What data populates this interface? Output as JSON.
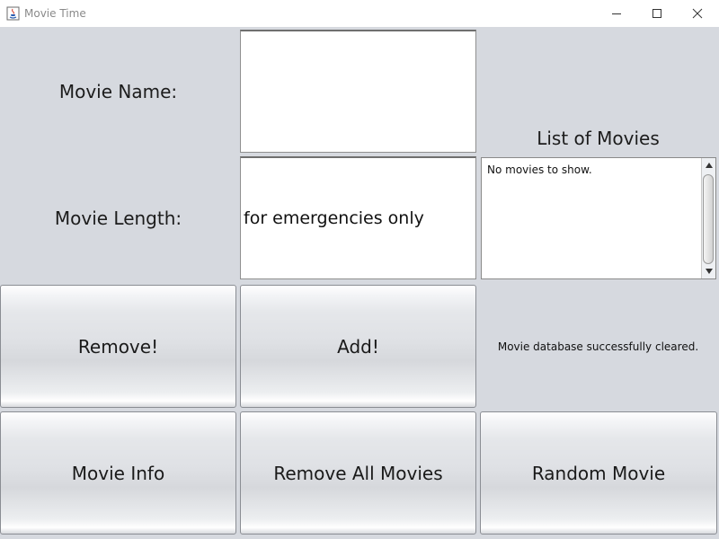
{
  "window": {
    "title": "Movie Time",
    "icons": [
      "java-cup-icon",
      "minimize-icon",
      "maximize-icon",
      "close-icon"
    ]
  },
  "form": {
    "movie_name_label": "Movie Name:",
    "movie_name_value": "",
    "movie_length_label": "Movie Length:",
    "movie_length_value": "for emergencies only"
  },
  "movie_list": {
    "heading": "List of Movies",
    "content": "No movies to show."
  },
  "buttons": {
    "remove": "Remove!",
    "add": "Add!",
    "movie_info": "Movie Info",
    "remove_all": "Remove All Movies",
    "random": "Random Movie"
  },
  "status": {
    "message": "Movie database successfully cleared."
  }
}
